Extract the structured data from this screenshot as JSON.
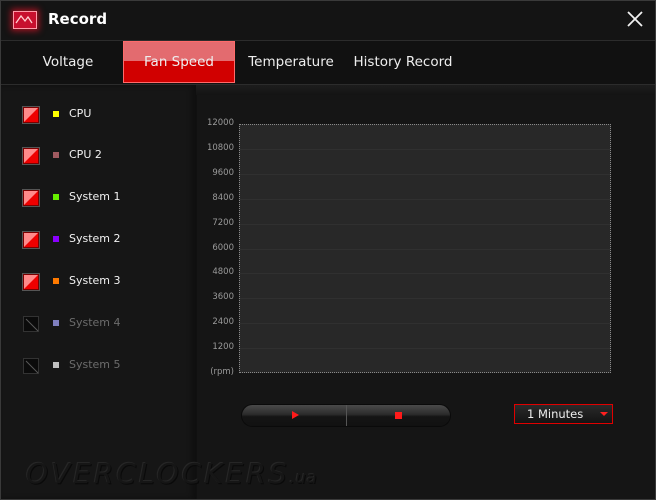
{
  "window": {
    "title": "Record",
    "icon": "waveform-record-icon",
    "close_icon": "close-icon"
  },
  "tabs": [
    {
      "label": "Voltage",
      "active": false
    },
    {
      "label": "Fan Speed",
      "active": true
    },
    {
      "label": "Temperature",
      "active": false
    },
    {
      "label": "History Record",
      "active": false
    }
  ],
  "sidebar": {
    "items": [
      {
        "label": "CPU",
        "checked": true,
        "enabled": true,
        "color": "#ffff00"
      },
      {
        "label": "CPU 2",
        "checked": true,
        "enabled": true,
        "color": "#a05a60"
      },
      {
        "label": "System 1",
        "checked": true,
        "enabled": true,
        "color": "#66ee00"
      },
      {
        "label": "System 2",
        "checked": true,
        "enabled": true,
        "color": "#8a00ff"
      },
      {
        "label": "System 3",
        "checked": true,
        "enabled": true,
        "color": "#ff7a00"
      },
      {
        "label": "System 4",
        "checked": false,
        "enabled": false,
        "color": "#8080c0"
      },
      {
        "label": "System 5",
        "checked": false,
        "enabled": false,
        "color": "#c0c0c0"
      }
    ]
  },
  "chart_data": {
    "type": "line",
    "title": "",
    "xlabel": "",
    "ylabel": "(rpm)",
    "ylim": [
      0,
      12000
    ],
    "yticks": [
      12000,
      10800,
      9600,
      8400,
      7200,
      6000,
      4800,
      3600,
      2400,
      1200
    ],
    "grid": true,
    "series": []
  },
  "controls": {
    "play_icon": "play-icon",
    "stop_icon": "stop-icon",
    "interval": {
      "selected": "1 Minutes"
    }
  },
  "watermark": {
    "text": "OVERCLOCKERS",
    "tld": ".ua"
  }
}
